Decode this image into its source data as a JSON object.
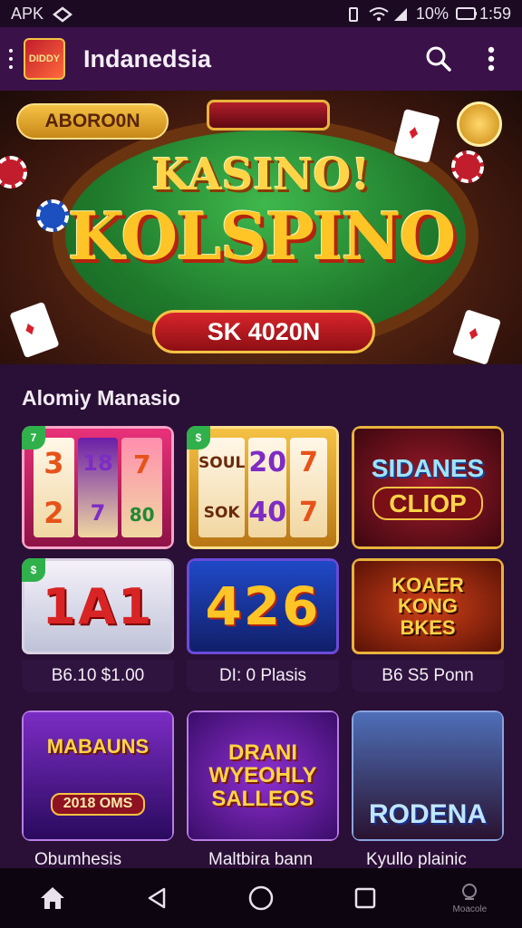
{
  "status_bar": {
    "left_text": "APK",
    "battery_text": "10%",
    "time": "1:59"
  },
  "app_bar": {
    "logo_text": "DIDDY",
    "title": "Indanedsia"
  },
  "banner": {
    "pill_label": "ABORO0N",
    "title_line_1": "KASINO!",
    "title_line_2": "KOLSPINO",
    "cta_label": "SK 4020N"
  },
  "section": {
    "title": "Alomiy Manasio"
  },
  "games": {
    "row1": [
      {
        "reels": [
          [
            "3",
            "2"
          ],
          [
            "18",
            "7"
          ],
          [
            "7",
            "80"
          ]
        ],
        "badge": "7"
      },
      {
        "reels": [
          [
            "SOUL",
            "SOK"
          ],
          [
            "20",
            "40"
          ],
          [
            "7",
            "7"
          ]
        ],
        "badge": "$"
      },
      {
        "title": "SIDANES",
        "subtitle": "CLIOP"
      }
    ],
    "row2": [
      {
        "digits": "1A1",
        "label": "B6.10 $1.00",
        "badge": "$"
      },
      {
        "digits": "426",
        "label": "DI: 0 Plasis",
        "badge": ""
      },
      {
        "title": "KOAER KONG BKES",
        "label": "B6 S5 Ponn"
      }
    ],
    "row3": [
      {
        "title": "MABAUNS",
        "banner": "2018 OMS",
        "caption": "Obumhesis"
      },
      {
        "title": "DRANI WYEOHLY SALLEOS",
        "caption": "Maltbira bann"
      },
      {
        "title": "RODENA",
        "caption": "Kyullo plainic"
      }
    ]
  },
  "nav_bar": {
    "items": [
      "home",
      "back",
      "home-circle",
      "recents",
      "assistant"
    ],
    "assistant_label": "Moacole"
  },
  "colors": {
    "background": "#2a0f36",
    "app_bar": "#3b1149",
    "accent_gold": "#f5c244",
    "accent_red": "#d8252c"
  }
}
